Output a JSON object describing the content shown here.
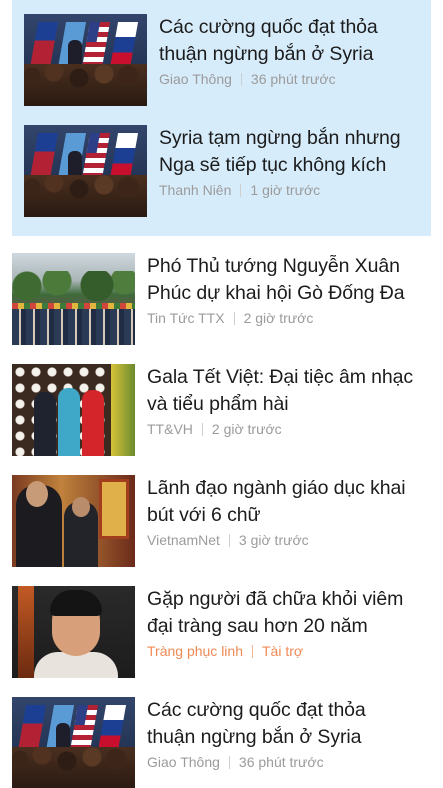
{
  "news_feed": {
    "featured_cluster": [
      {
        "title": "Các cường quốc đạt thỏa thuận ngừng bắn ở Syria",
        "source": "Giao Thông",
        "time": "36 phút trước",
        "thumbnail_icon": "un-flags-photo"
      },
      {
        "title": "Syria tạm ngừng bắn nhưng Nga sẽ tiếp tục không kích",
        "source": "Thanh Niên",
        "time": "1 giờ trước",
        "thumbnail_icon": "un-flags-photo"
      }
    ],
    "items": [
      {
        "title": "Phó Thủ tướng Nguyễn Xuân Phúc dự khai hội Gò Đống Đa",
        "source": "Tin Tức TTX",
        "time": "2 giờ trước",
        "thumbnail_icon": "ceremony-photo"
      },
      {
        "title": "Gala Tết Việt: Đại tiệc âm nhạc và tiểu phẩm hài",
        "source": "TT&VH",
        "time": "2 giờ trước",
        "thumbnail_icon": "gala-photo"
      },
      {
        "title": "Lãnh đạo ngành giáo dục khai bút với 6 chữ",
        "source": "VietnamNet",
        "time": "3 giờ trước",
        "thumbnail_icon": "education-photo"
      },
      {
        "title": "Gặp người đã chữa khỏi viêm đại tràng sau hơn 20 năm",
        "source": "Tràng phục linh",
        "time": "Tài trợ",
        "sponsored": true,
        "thumbnail_icon": "portrait-photo"
      },
      {
        "title": "Các cường quốc đạt thỏa thuận ngừng bắn ở Syria",
        "source": "Giao Thông",
        "time": "36 phút trước",
        "thumbnail_icon": "un-flags-photo"
      }
    ]
  },
  "colors": {
    "cluster_background": "#d7ecfb",
    "meta_text": "#9b9b9b",
    "sponsored_text": "#f08a55"
  }
}
